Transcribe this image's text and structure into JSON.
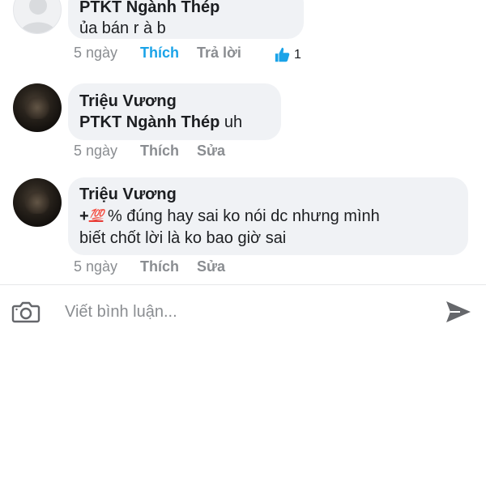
{
  "comments": [
    {
      "author": "PTKT Ngành Thép",
      "text": "ủa bán r à b",
      "time": "5 ngày",
      "like_label": "Thích",
      "reply_label": "Trả lời",
      "reaction_count": "1",
      "avatar_icon": "profile-placeholder"
    },
    {
      "author": "Triệu Vương",
      "mention": "PTKT Ngành Thép",
      "text": "uh",
      "time": "5 ngày",
      "like_label": "Thích",
      "edit_label": "Sửa",
      "avatar_icon": "profile-photo"
    },
    {
      "author": "Triệu Vương",
      "prefix": "+",
      "emoji": "💯",
      "line1": "%  đúng hay sai ko nói dc nhưng mình",
      "line2": "biết chốt lời là ko bao giờ sai",
      "time": "5 ngày",
      "like_label": "Thích",
      "edit_label": "Sửa",
      "avatar_icon": "profile-photo"
    }
  ],
  "composer": {
    "placeholder": "Viết bình luận...",
    "camera_icon": "camera-icon",
    "send_icon": "send-icon"
  },
  "colors": {
    "liked": "#1aa3e8",
    "bubble": "#f0f2f5",
    "meta_text": "#8a8d91",
    "emoji_red": "#e53935"
  }
}
